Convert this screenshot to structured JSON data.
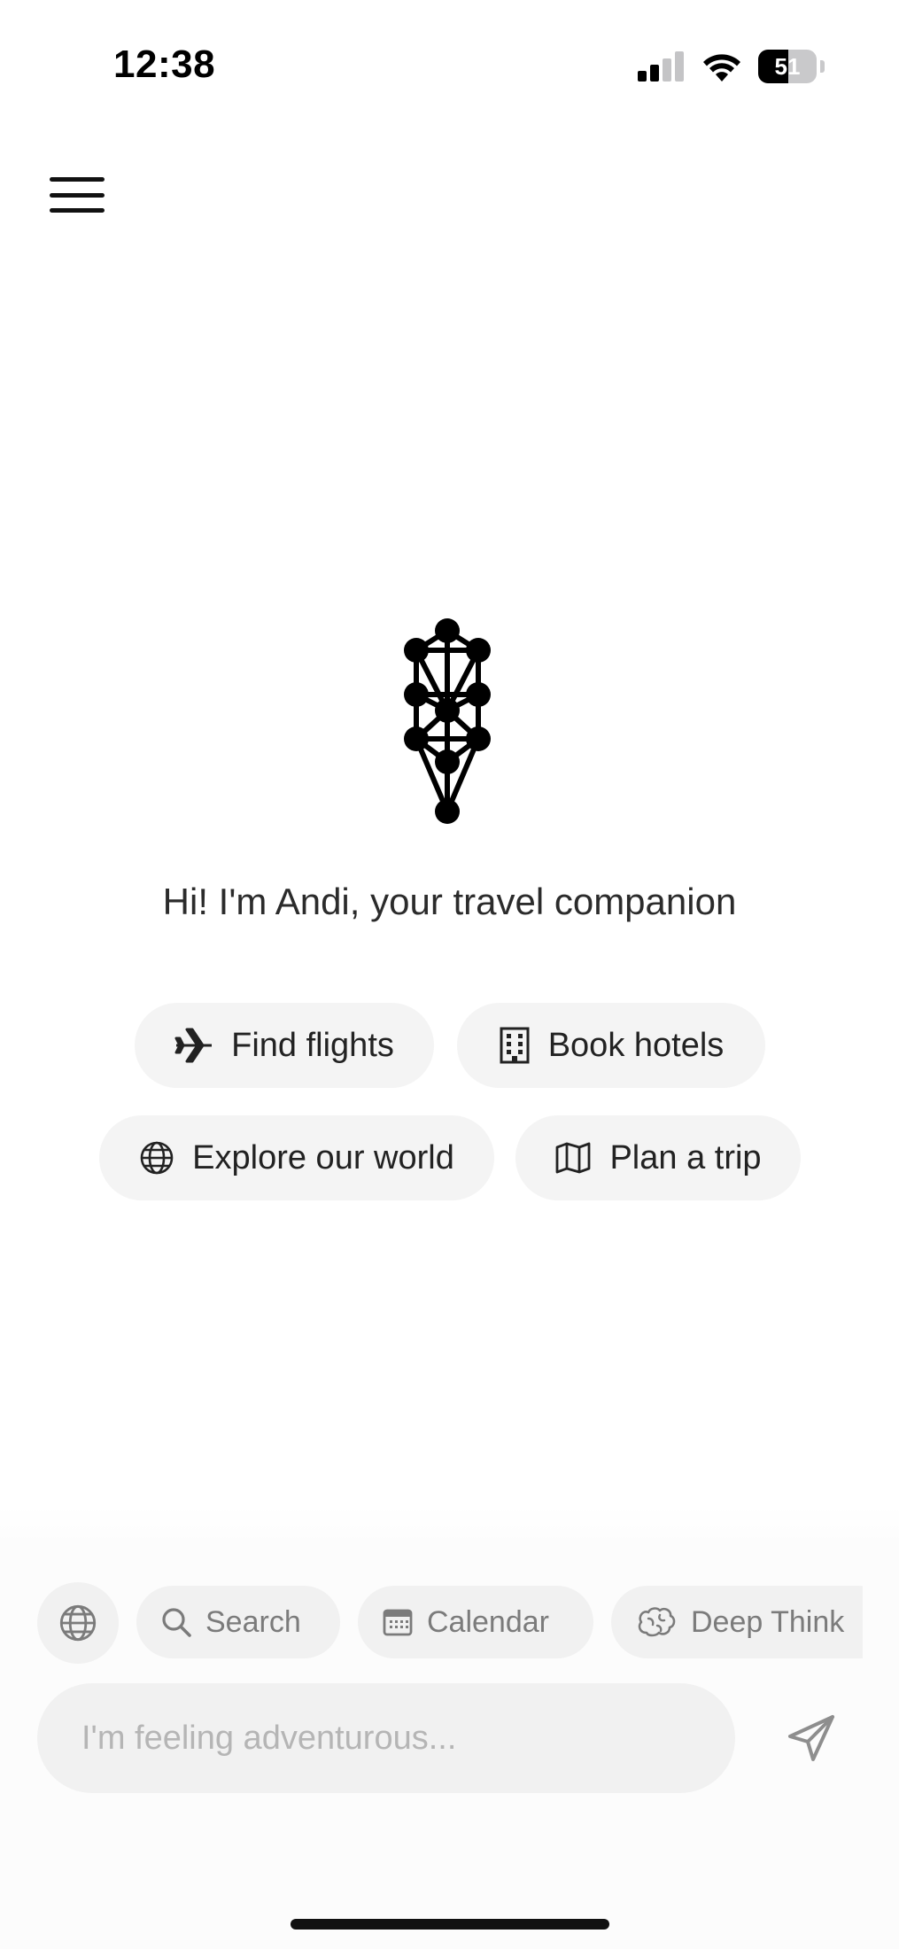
{
  "status_bar": {
    "time": "12:38",
    "battery": "51"
  },
  "greeting": "Hi! I'm Andi, your travel companion",
  "quick_actions": {
    "find_flights": "Find flights",
    "book_hotels": "Book hotels",
    "explore_world": "Explore our world",
    "plan_trip": "Plan a trip"
  },
  "tools": {
    "search": "Search",
    "calendar": "Calendar",
    "deep_think": "Deep Think"
  },
  "composer": {
    "placeholder": "I'm feeling adventurous..."
  },
  "icons": {
    "menu": "hamburger-menu-icon",
    "logo": "tree-of-life-logo",
    "flights": "airplane-icon",
    "hotels": "building-icon",
    "explore": "globe-icon",
    "plan": "map-icon",
    "search": "magnifier-icon",
    "calendar": "calendar-icon",
    "deep_think": "brain-icon",
    "send": "paper-plane-icon"
  },
  "colors": {
    "chip_bg": "#f4f4f4",
    "text": "#222222",
    "muted": "#7b7b7b",
    "placeholder": "#b5b5b5"
  }
}
